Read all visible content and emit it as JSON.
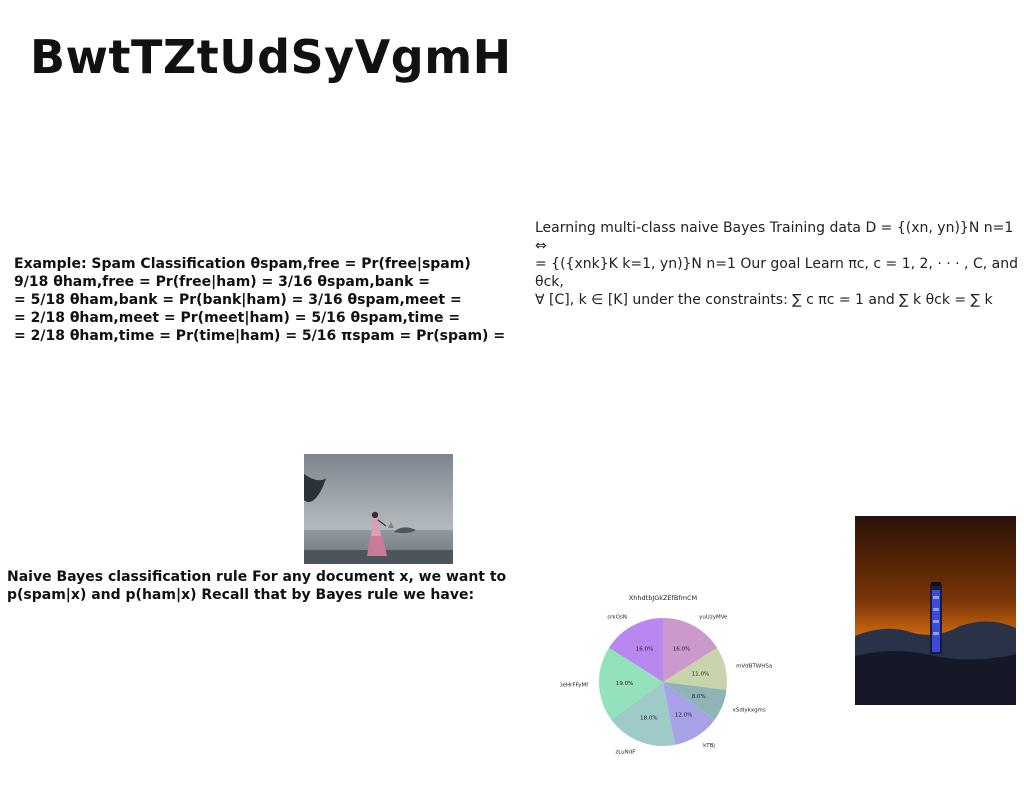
{
  "header": {
    "title": "BwtTZtUdSyVgmH"
  },
  "blocks": {
    "spam_example": "Example: Spam Classification θspam,free = Pr(free|spam)\n9/18 θham,free = Pr(free|ham) = 3/16 θspam,bank =\n= 5/18 θham,bank = Pr(bank|ham) = 3/16 θspam,meet =\n= 2/18 θham,meet = Pr(meet|ham) = 5/16 θspam,time =\n= 2/18 θham,time = Pr(time|ham) = 5/16 πspam = Pr(spam) =",
    "learning": "Learning multi-class naive Bayes Training data D = {(xn, yn)}N n=1 ⇔\n= {({xnk}K k=1, yn)}N n=1 Our goal Learn πc, c = 1, 2, · · · , C, and θck,\n∀ [C], k ∈ [K] under the constraints: ∑ c πc = 1 and ∑ k θck = ∑ k",
    "naive_bayes": "Naive Bayes classification rule For any document x, we want to\np(spam|x) and p(ham|x) Recall that by Bayes rule we have:"
  },
  "images": {
    "woman": {
      "description": "woman-on-shore-photo"
    },
    "tower": {
      "description": "tower-at-sunset-photo"
    }
  },
  "chart_data": {
    "type": "pie",
    "title": "XhhdtbJGkZEfBfmCM",
    "categories": [
      "yuUzyMVe",
      "mVdBTWHSa",
      "xSdlykxgms",
      "kTBj",
      "zLuNdF",
      "DeHrFFyMf",
      "srkOsN"
    ],
    "values": [
      16.0,
      11.0,
      8.0,
      12.0,
      18.0,
      19.0,
      16.0
    ],
    "value_labels": [
      "16.0%",
      "11.0%",
      "8.0%",
      "12.0%",
      "18.0%",
      "19.0%",
      "16.0%"
    ],
    "colors": [
      "#cc99cc",
      "#c8d4ac",
      "#8fb4b8",
      "#a7a2e6",
      "#9ecac8",
      "#93e2bc",
      "#b887f0"
    ]
  }
}
